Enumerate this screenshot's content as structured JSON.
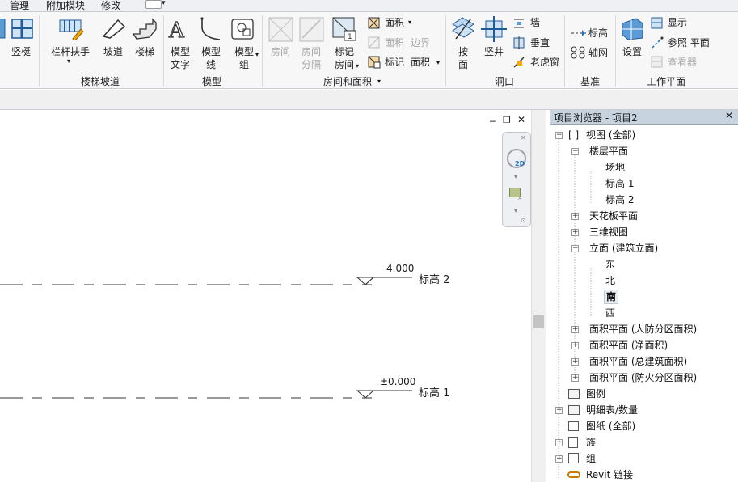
{
  "tabs": [
    "管理",
    "附加模块",
    "修改"
  ],
  "ribbon": {
    "partial_left": {
      "label": "竖梃"
    },
    "stairs_panel": {
      "title": "楼梯坡道",
      "railing": "栏杆扶手",
      "ramp": "坡道",
      "stair": "楼梯"
    },
    "model_panel": {
      "title": "模型",
      "model_text": [
        "模型",
        "文字"
      ],
      "model_line": [
        "模型",
        "线"
      ],
      "model_group": [
        "模型",
        "组"
      ]
    },
    "room_panel": {
      "title": "房间和面积",
      "room": "房间",
      "room_sep": [
        "房间",
        "分隔"
      ],
      "tag_room": [
        "标记",
        "房间"
      ],
      "area": "面积",
      "area_boundary_a": "面积",
      "area_boundary_b": "边界",
      "tag_area_a": "标记",
      "tag_area_b": "面积"
    },
    "opening_panel": {
      "title": "洞口",
      "by_face": [
        "按",
        "面"
      ],
      "shaft": "竖井",
      "wall": "墙",
      "vertical": "垂直",
      "dormer": "老虎窗"
    },
    "datum_panel": {
      "title": "基准",
      "level": "标高",
      "grid": "轴网"
    },
    "workplane_panel": {
      "title": "工作平面",
      "set": "设置",
      "show": "显示",
      "ref_plane": "参照 平面",
      "viewer": "查看器"
    }
  },
  "canvas": {
    "levels": [
      {
        "name": "标高 2",
        "elevation": "4.000"
      },
      {
        "name": "标高 1",
        "elevation": "±0.000"
      }
    ],
    "navbar_2d": "2D"
  },
  "browser": {
    "title": "项目浏览器 - 项目2",
    "tree": {
      "views": "视图 (全部)",
      "floor_plans": "楼层平面",
      "site": "场地",
      "level1": "标高 1",
      "level2": "标高 2",
      "ceiling_plans": "天花板平面",
      "views_3d": "三维视图",
      "elevations": "立面 (建筑立面)",
      "east": "东",
      "north": "北",
      "south": "南",
      "west": "西",
      "area_civil": "面积平面 (人防分区面积)",
      "area_net": "面积平面 (净面积)",
      "area_gross": "面积平面 (总建筑面积)",
      "area_fire": "面积平面 (防火分区面积)",
      "legends": "图例",
      "schedules": "明细表/数量",
      "sheets": "图纸 (全部)",
      "families": "族",
      "groups": "组",
      "revit_links": "Revit 链接"
    }
  },
  "colors": {
    "accent": "#1f6fbf",
    "header_bg": "#c8d3e0",
    "disabled": "#a8a8a8"
  }
}
